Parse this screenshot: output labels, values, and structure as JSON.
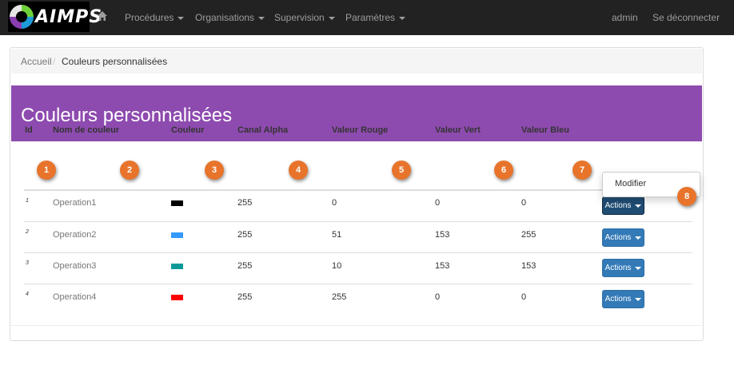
{
  "navbar": {
    "brand": "AIMPS",
    "menus": [
      "Procédures",
      "Organisations",
      "Supervision",
      "Paramètres"
    ],
    "user": "admin",
    "logout": "Se déconnecter"
  },
  "breadcrumb": {
    "home": "Accueil",
    "separator": "/",
    "current": "Couleurs personnalisées"
  },
  "page": {
    "title": "Couleurs personnalisées"
  },
  "table": {
    "headers": [
      "Id",
      "Nom de couleur",
      "Couleur",
      "Canal Alpha",
      "Valeur Rouge",
      "Valeur Vert",
      "Valeur Bleu"
    ],
    "rows": [
      {
        "id": "1",
        "name": "Operation1",
        "swatch": "#000000",
        "alpha": "255",
        "red": "0",
        "green": "0",
        "blue": "0"
      },
      {
        "id": "2",
        "name": "Operation2",
        "swatch": "#3399ff",
        "alpha": "255",
        "red": "51",
        "green": "153",
        "blue": "255"
      },
      {
        "id": "3",
        "name": "Operation3",
        "swatch": "#0a9999",
        "alpha": "255",
        "red": "10",
        "green": "153",
        "blue": "153"
      },
      {
        "id": "4",
        "name": "Operation4",
        "swatch": "#ff0000",
        "alpha": "255",
        "red": "255",
        "green": "0",
        "blue": "0"
      }
    ],
    "actions_label": "Actions",
    "dropdown_item": "Modifier"
  },
  "callouts": [
    "1",
    "2",
    "3",
    "4",
    "5",
    "6",
    "7",
    "8"
  ],
  "colors": {
    "navbar": "#222222",
    "banner": "#8e4baf",
    "primary_button": "#337ab7",
    "callout": "#e8742b"
  },
  "icons": {
    "home": "home-icon",
    "caret": "caret-down-icon"
  }
}
